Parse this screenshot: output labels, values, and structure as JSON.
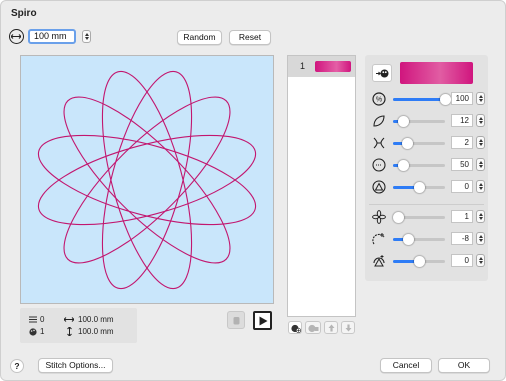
{
  "dialog": {
    "title": "Spiro"
  },
  "size": {
    "value": "100 mm"
  },
  "buttons": {
    "random": "Random",
    "reset": "Reset",
    "stitch_options": "Stitch Options...",
    "cancel": "Cancel",
    "ok": "OK",
    "help": "?"
  },
  "info": {
    "stitch_count": "0",
    "color_count": "1",
    "width": "100.0 mm",
    "height": "100.0 mm"
  },
  "colors": {
    "list": [
      {
        "index": "1",
        "hex": "#d0157e"
      }
    ],
    "current_swatch": "#d0157e"
  },
  "params": [
    {
      "icon": "percent-icon",
      "value": "100",
      "level": 1.0
    },
    {
      "icon": "petal-icon",
      "value": "12",
      "level": 0.2
    },
    {
      "icon": "twist-icon",
      "value": "2",
      "level": 0.28
    },
    {
      "icon": "circle-dots-icon",
      "value": "50",
      "level": 0.2
    },
    {
      "icon": "triangle-circle-icon",
      "value": "0",
      "level": 0.5
    },
    {
      "icon": "flower-icon",
      "value": "1",
      "level": 0.1
    },
    {
      "icon": "arc-plus-icon",
      "value": "-8",
      "level": 0.3
    },
    {
      "icon": "arc-triangle-icon",
      "value": "0",
      "level": 0.5
    }
  ],
  "theme": {
    "accent": "#2e7cf6",
    "curve": "#c2176f",
    "canvas_bg": "#c9e6fb"
  }
}
